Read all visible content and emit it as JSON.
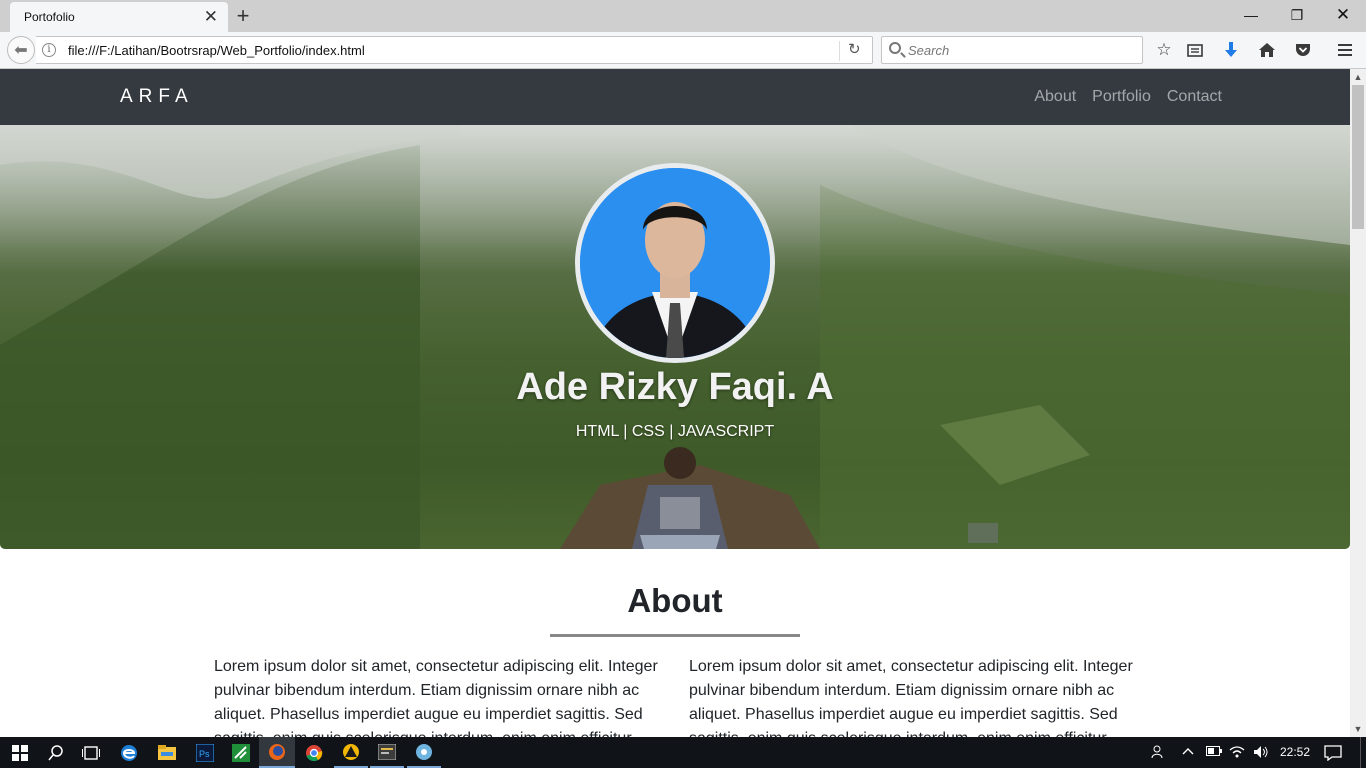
{
  "browser": {
    "tab_title": "Portofolio",
    "tab_close": "✕",
    "new_tab": "+",
    "window_controls": {
      "minimize": "—",
      "restore": "❐",
      "close": "✕"
    },
    "url": "file:///F:/Latihan/Bootrsrap/Web_Portfolio/index.html",
    "search_placeholder": "Search",
    "toolbar_icons": [
      "star-icon",
      "reading-list-icon",
      "download-icon",
      "home-icon",
      "pocket-icon",
      "menu-icon"
    ]
  },
  "site": {
    "brand": "ARFA",
    "nav": [
      "About",
      "Portfolio",
      "Contact"
    ],
    "hero": {
      "name": "Ade Rizky Faqi. A",
      "skills": "HTML | CSS | JAVASCRIPT"
    },
    "about": {
      "title": "About",
      "col1": "Lorem ipsum dolor sit amet, consectetur adipiscing elit. Integer pulvinar bibendum interdum. Etiam dignissim ornare nibh ac aliquet. Phasellus imperdiet augue eu imperdiet sagittis. Sed sagittis, enim quis scelerisque interdum, enim enim efficitur",
      "col2": "Lorem ipsum dolor sit amet, consectetur adipiscing elit. Integer pulvinar bibendum interdum. Etiam dignissim ornare nibh ac aliquet. Phasellus imperdiet augue eu imperdiet sagittis. Sed sagittis, enim quis scelerisque interdum, enim enim efficitur"
    }
  },
  "taskbar": {
    "clock": "22:52",
    "apps": [
      "start-icon",
      "search-icon",
      "task-view-icon",
      "edge-icon",
      "file-explorer-icon",
      "photoshop-icon",
      "app-icon",
      "firefox-icon",
      "chrome-icon",
      "app-icon",
      "app-icon",
      "app-icon"
    ]
  },
  "colors": {
    "navbar_bg": "#343a40",
    "avatar_bg": "#2b8ff0"
  }
}
